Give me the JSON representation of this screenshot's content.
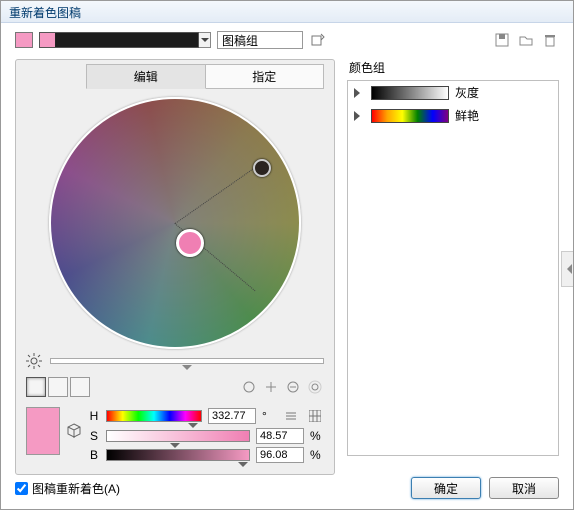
{
  "title": "重新着色图稿",
  "toolbar": {
    "artgroup_label": "图稿组"
  },
  "tabs": {
    "edit": "编辑",
    "assign": "指定"
  },
  "hsb": {
    "h_label": "H",
    "s_label": "S",
    "b_label": "B",
    "h_value": "332.77",
    "h_unit": "°",
    "s_value": "48.57",
    "s_unit": "%",
    "b_value": "96.08",
    "b_unit": "%"
  },
  "color_groups": {
    "header": "颜色组",
    "items": [
      {
        "label": "灰度"
      },
      {
        "label": "鲜艳"
      }
    ]
  },
  "footer": {
    "recolor_label": "图稿重新着色(A)",
    "ok": "确定",
    "cancel": "取消"
  }
}
